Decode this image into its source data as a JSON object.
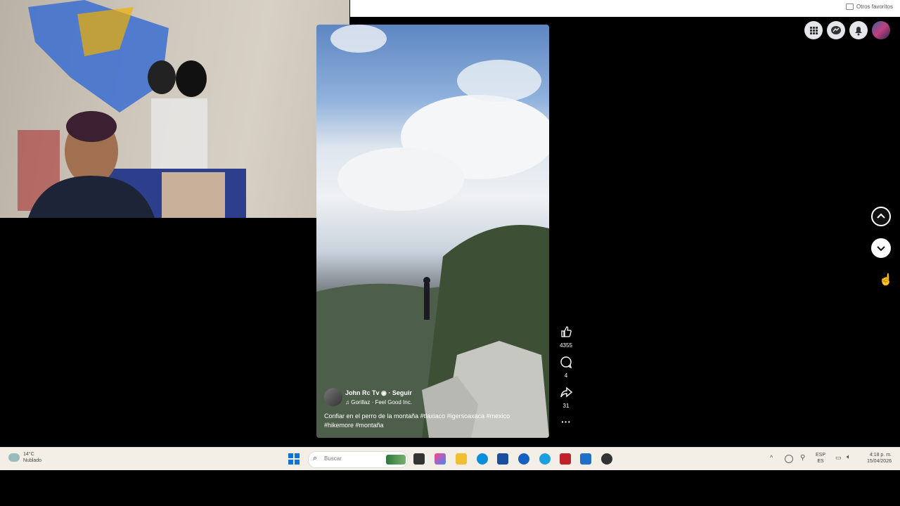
{
  "bookmarks": {
    "other_favorites": "Otros favoritos"
  },
  "post": {
    "author": "John Rc Tv",
    "follow_label": "Seguir",
    "audio": "Gorillaz · Feel Good Inc.",
    "caption_line1": "Confiar en el perro de la montaña #tlaxiaco  #igersoaxaca #mexico",
    "caption_line2": "#hikemore #montaña"
  },
  "actions": {
    "likes": "4355",
    "comments": "4",
    "shares": "31"
  },
  "weather": {
    "temp": "14°C",
    "condition": "Nublado"
  },
  "taskbar": {
    "search_placeholder": "Buscar",
    "lang_top": "ESP",
    "lang_bottom": "ES",
    "time": "4:18 p. m.",
    "date": "15/04/2026"
  },
  "colors": {
    "accent": "#1877f2"
  }
}
